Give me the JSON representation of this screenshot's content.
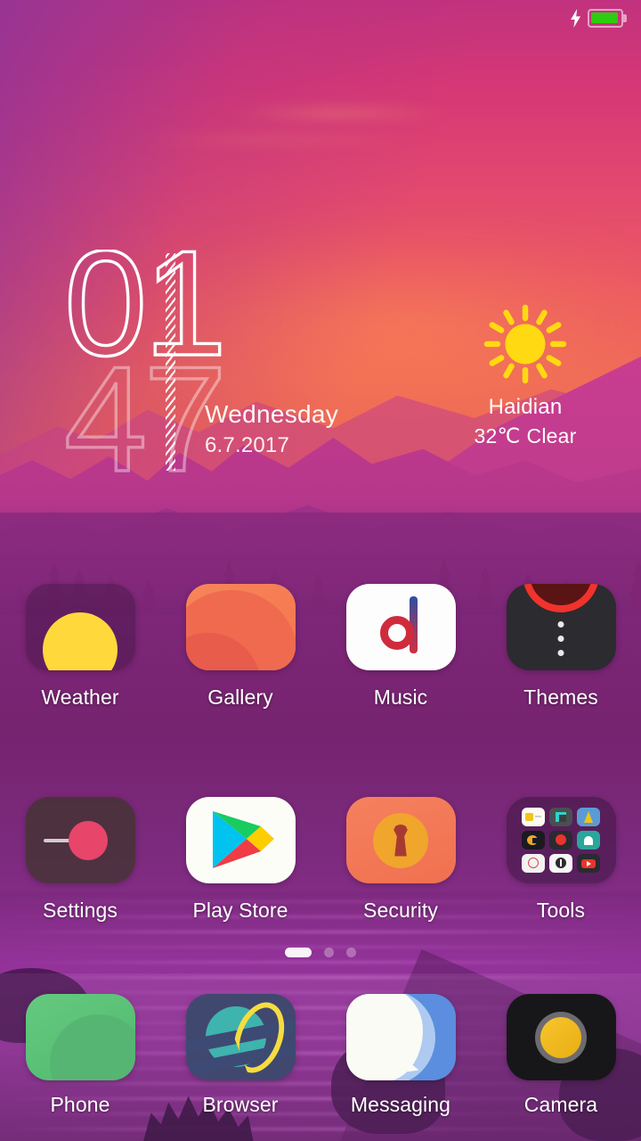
{
  "status_bar": {
    "charging_icon": "lightning-bolt-icon",
    "battery_icon": "battery-full-icon",
    "battery_color": "#2ecc0f"
  },
  "clock_widget": {
    "hour": "01",
    "minute": "47",
    "weekday": "Wednesday",
    "date": "6.7.2017",
    "divider_icon": "hatched-divider"
  },
  "weather_widget": {
    "icon": "sun-icon",
    "sun_color": "#FFD911",
    "city": "Haidian",
    "temperature": "32℃",
    "condition": "Clear"
  },
  "app_grid": {
    "rows": [
      [
        {
          "label": "Weather",
          "icon": "weather-app-icon"
        },
        {
          "label": "Gallery",
          "icon": "gallery-app-icon"
        },
        {
          "label": "Music",
          "icon": "music-app-icon"
        },
        {
          "label": "Themes",
          "icon": "themes-app-icon"
        }
      ],
      [
        {
          "label": "Settings",
          "icon": "settings-app-icon"
        },
        {
          "label": "Play Store",
          "icon": "play-store-app-icon"
        },
        {
          "label": "Security",
          "icon": "security-app-icon"
        },
        {
          "label": "Tools",
          "icon": "tools-folder-icon"
        }
      ]
    ]
  },
  "tools_folder": {
    "mini_icons": [
      "notes-icon",
      "screen-recorder-icon",
      "compass-icon",
      "file-manager-icon",
      "recorder-icon",
      "contacts-icon",
      "clock-icon",
      "compass-dark-icon",
      "video-icon"
    ]
  },
  "page_indicator": {
    "total": 3,
    "active": 1
  },
  "dock": {
    "items": [
      {
        "label": "Phone",
        "icon": "phone-app-icon"
      },
      {
        "label": "Browser",
        "icon": "browser-app-icon"
      },
      {
        "label": "Messaging",
        "icon": "messaging-app-icon"
      },
      {
        "label": "Camera",
        "icon": "camera-app-icon"
      }
    ]
  }
}
